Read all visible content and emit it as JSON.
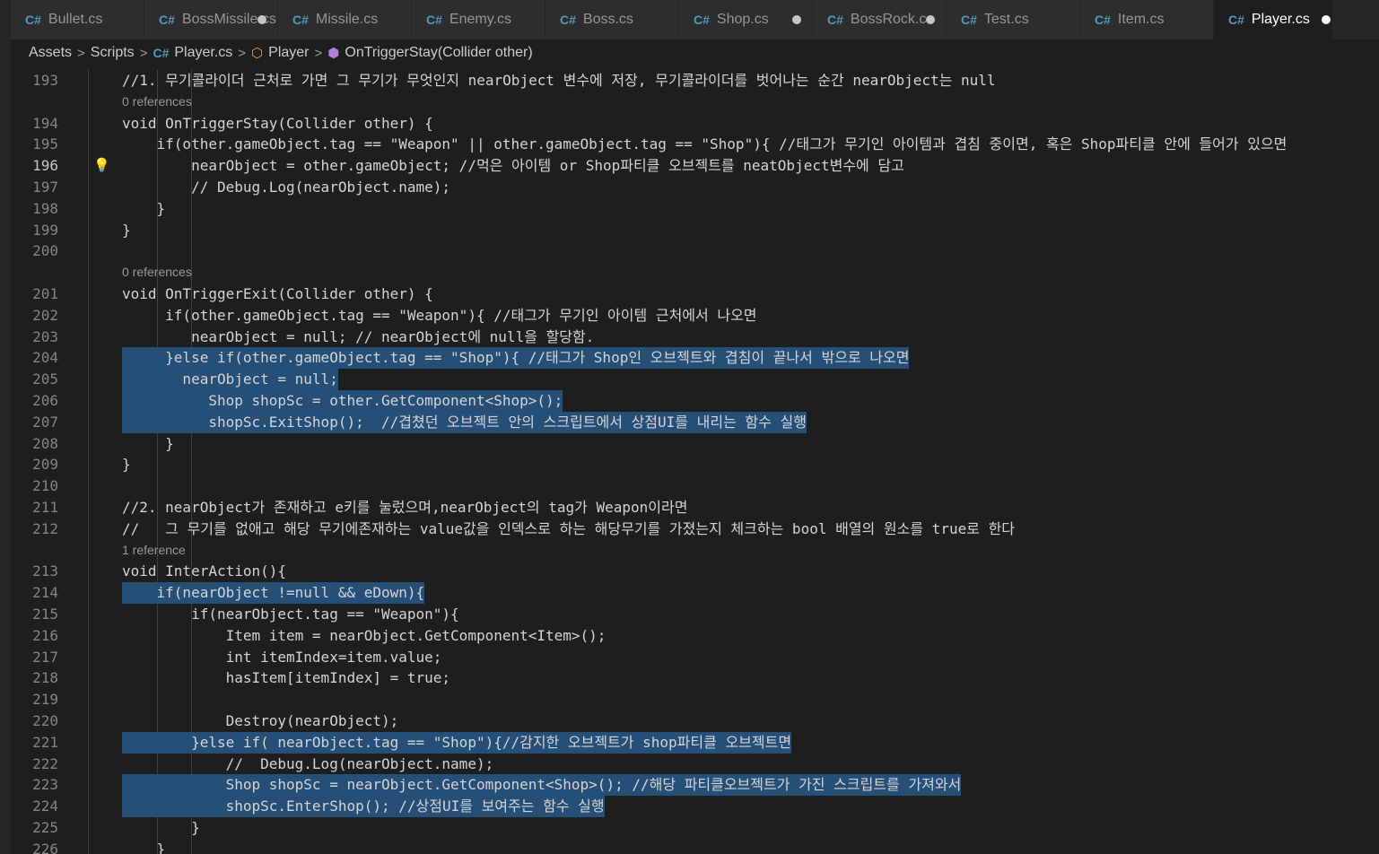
{
  "tabs": [
    {
      "label": "Bullet.cs",
      "dirty": false,
      "active": false
    },
    {
      "label": "BossMissile.cs",
      "dirty": true,
      "active": false
    },
    {
      "label": "Missile.cs",
      "dirty": false,
      "active": false
    },
    {
      "label": "Enemy.cs",
      "dirty": false,
      "active": false
    },
    {
      "label": "Boss.cs",
      "dirty": false,
      "active": false
    },
    {
      "label": "Shop.cs",
      "dirty": true,
      "active": false
    },
    {
      "label": "BossRock.cs",
      "dirty": true,
      "active": false
    },
    {
      "label": "Test.cs",
      "dirty": false,
      "active": false
    },
    {
      "label": "Item.cs",
      "dirty": false,
      "active": false
    },
    {
      "label": "Player.cs",
      "dirty": true,
      "active": true
    }
  ],
  "breadcrumb": {
    "assets": "Assets",
    "scripts": "Scripts",
    "file": "Player.cs",
    "class": "Player",
    "method": "OnTriggerStay(Collider other)"
  },
  "icons": {
    "tab_file": "csharp-file-icon",
    "breadcrumb_sep": "chevron-right-icon",
    "class": "class-icon",
    "method": "method-icon",
    "lightbulb": "lightbulb-icon"
  },
  "colors": {
    "keyword": "#569cd6",
    "comment": "#6a9955",
    "string": "#ce9178",
    "type": "#4ec9b0",
    "selection": "#264f78"
  },
  "lens": {
    "l193": "0 references",
    "l200": "0 references",
    "l212": "1 reference"
  },
  "code": {
    "l193": "//1. 무기콜라이더 근처로 가면 그 무기가 무엇인지 nearObject 변수에 저장, 무기콜라이더를 벗어나는 순간 nearObject는 null",
    "l194": "void OnTriggerStay(Collider other) {",
    "l195": "    if(other.gameObject.tag == \"Weapon\" || other.gameObject.tag == \"Shop\"){ //태그가 무기인 아이템과 겹침 중이면, 혹은 Shop파티클 안에 들어가 있으면",
    "l196": "        nearObject = other.gameObject; //먹은 아이템 or Shop파티클 오브젝트를 neatObject변수에 담고",
    "l197": "        // Debug.Log(nearObject.name);",
    "l198": "    }",
    "l199": "}",
    "l200": "",
    "l201": "void OnTriggerExit(Collider other) {",
    "l202": "     if(other.gameObject.tag == \"Weapon\"){ //태그가 무기인 아이템 근처에서 나오면",
    "l203": "        nearObject = null; // nearObject에 null을 할당함.",
    "l204": "     }else if(other.gameObject.tag == \"Shop\"){ //태그가 Shop인 오브젝트와 겹침이 끝나서 밖으로 나오면",
    "l205": "       nearObject = null;",
    "l206": "          Shop shopSc = other.GetComponent<Shop>();",
    "l207": "          shopSc.ExitShop();  //겹쳤던 오브젝트 안의 스크립트에서 상점UI를 내리는 함수 실행",
    "l208": "     }",
    "l209": "}",
    "l210": "",
    "l211": "//2. nearObject가 존재하고 e키를 눌렀으며,nearObject의 tag가 Weapon이라면",
    "l212": "//   그 무기를 없애고 해당 무기에존재하는 value값을 인덱스로 하는 해당무기를 가졌는지 체크하는 bool 배열의 원소를 true로 한다",
    "l213": "void InterAction(){",
    "l214": "    if(nearObject !=null && eDown){",
    "l215": "        if(nearObject.tag == \"Weapon\"){",
    "l216": "            Item item = nearObject.GetComponent<Item>();",
    "l217": "            int itemIndex=item.value;",
    "l218": "            hasItem[itemIndex] = true;",
    "l219": "",
    "l220": "            Destroy(nearObject);",
    "l221": "        }else if( nearObject.tag == \"Shop\"){//감지한 오브젝트가 shop파티클 오브젝트면",
    "l222": "            //  Debug.Log(nearObject.name);",
    "l223": "            Shop shopSc = nearObject.GetComponent<Shop>(); //해당 파티클오브젝트가 가진 스크립트를 가져와서",
    "l224": "            shopSc.EnterShop(); //상점UI를 보여주는 함수 실행",
    "l225": "        }",
    "l226": "    }"
  },
  "line_numbers": [
    "193",
    "194",
    "195",
    "196",
    "197",
    "198",
    "199",
    "200",
    "201",
    "202",
    "203",
    "204",
    "205",
    "206",
    "207",
    "208",
    "209",
    "210",
    "211",
    "212",
    "213",
    "214",
    "215",
    "216",
    "217",
    "218",
    "219",
    "220",
    "221",
    "222",
    "223",
    "224",
    "225",
    "226"
  ]
}
